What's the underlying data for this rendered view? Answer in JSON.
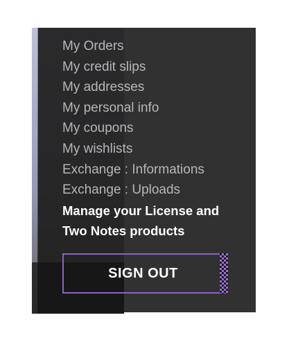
{
  "account_menu": {
    "items": [
      {
        "label": "My Orders",
        "highlight": false
      },
      {
        "label": "My credit slips",
        "highlight": false
      },
      {
        "label": "My addresses",
        "highlight": false
      },
      {
        "label": "My personal info",
        "highlight": false
      },
      {
        "label": "My coupons",
        "highlight": false
      },
      {
        "label": "My wishlists",
        "highlight": false
      },
      {
        "label": "Exchange : Informations",
        "highlight": false
      },
      {
        "label": "Exchange : Uploads",
        "highlight": false
      },
      {
        "label": "Manage your License and",
        "highlight": true
      },
      {
        "label": "Two Notes products",
        "highlight": true
      }
    ]
  },
  "signout": {
    "label": "SIGN OUT"
  },
  "colors": {
    "panel_bg": "#242424",
    "item_text": "#b7b7b7",
    "highlight_text": "#ffffff",
    "accent_purple": "#8e62c4"
  }
}
